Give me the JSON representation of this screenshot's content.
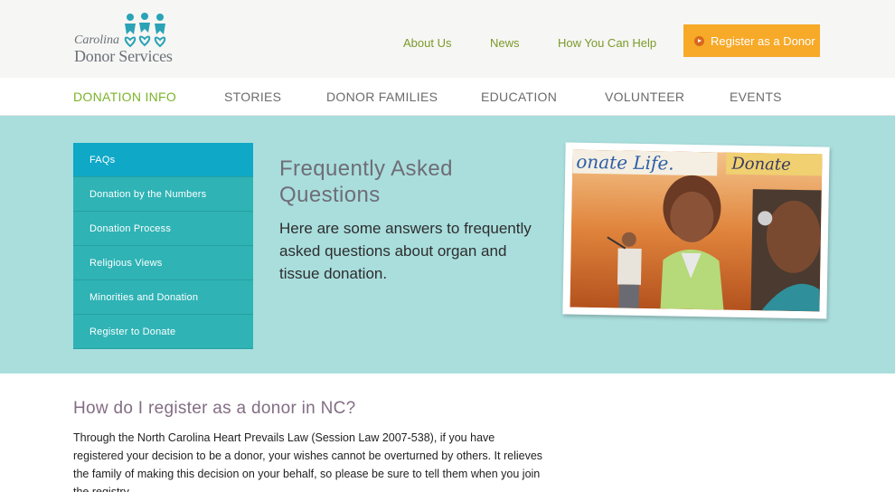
{
  "brand": {
    "name_line1": "Carolina",
    "name_line2": "Donor Services"
  },
  "top_links": [
    {
      "label": "About Us"
    },
    {
      "label": "News"
    },
    {
      "label": "How You Can Help"
    }
  ],
  "register_button": {
    "label": "Register as a Donor",
    "color": "#f7a928"
  },
  "main_nav": [
    {
      "label": "DONATION INFO",
      "active": true
    },
    {
      "label": "STORIES"
    },
    {
      "label": "DONOR FAMILIES"
    },
    {
      "label": "EDUCATION"
    },
    {
      "label": "VOLUNTEER"
    },
    {
      "label": "EVENTS"
    }
  ],
  "side_nav": [
    {
      "label": "FAQs",
      "active": true
    },
    {
      "label": "Donation by the Numbers"
    },
    {
      "label": "Donation Process"
    },
    {
      "label": "Religious Views"
    },
    {
      "label": "Minorities and Donation"
    },
    {
      "label": "Register to Donate"
    }
  ],
  "hero": {
    "title": "Frequently Asked Questions",
    "text": "Here are some answers to frequently asked questions about organ and tissue donation.",
    "photo_signs": [
      "onate Life.",
      "Donate"
    ]
  },
  "content": {
    "heading": "How do I register as a donor in NC?",
    "body": "Through the North Carolina Heart Prevails Law (Session Law 2007-538), if you have registered your decision to be a donor, your wishes cannot be overturned by others. It relieves the family of making this decision on your behalf, so please be sure to tell them when you join the registry."
  },
  "colors": {
    "accent_green": "#7cb32a",
    "hero_bg": "#a9dedd",
    "side_nav": "#2fb3b5",
    "side_nav_active": "#0fa8c7"
  }
}
